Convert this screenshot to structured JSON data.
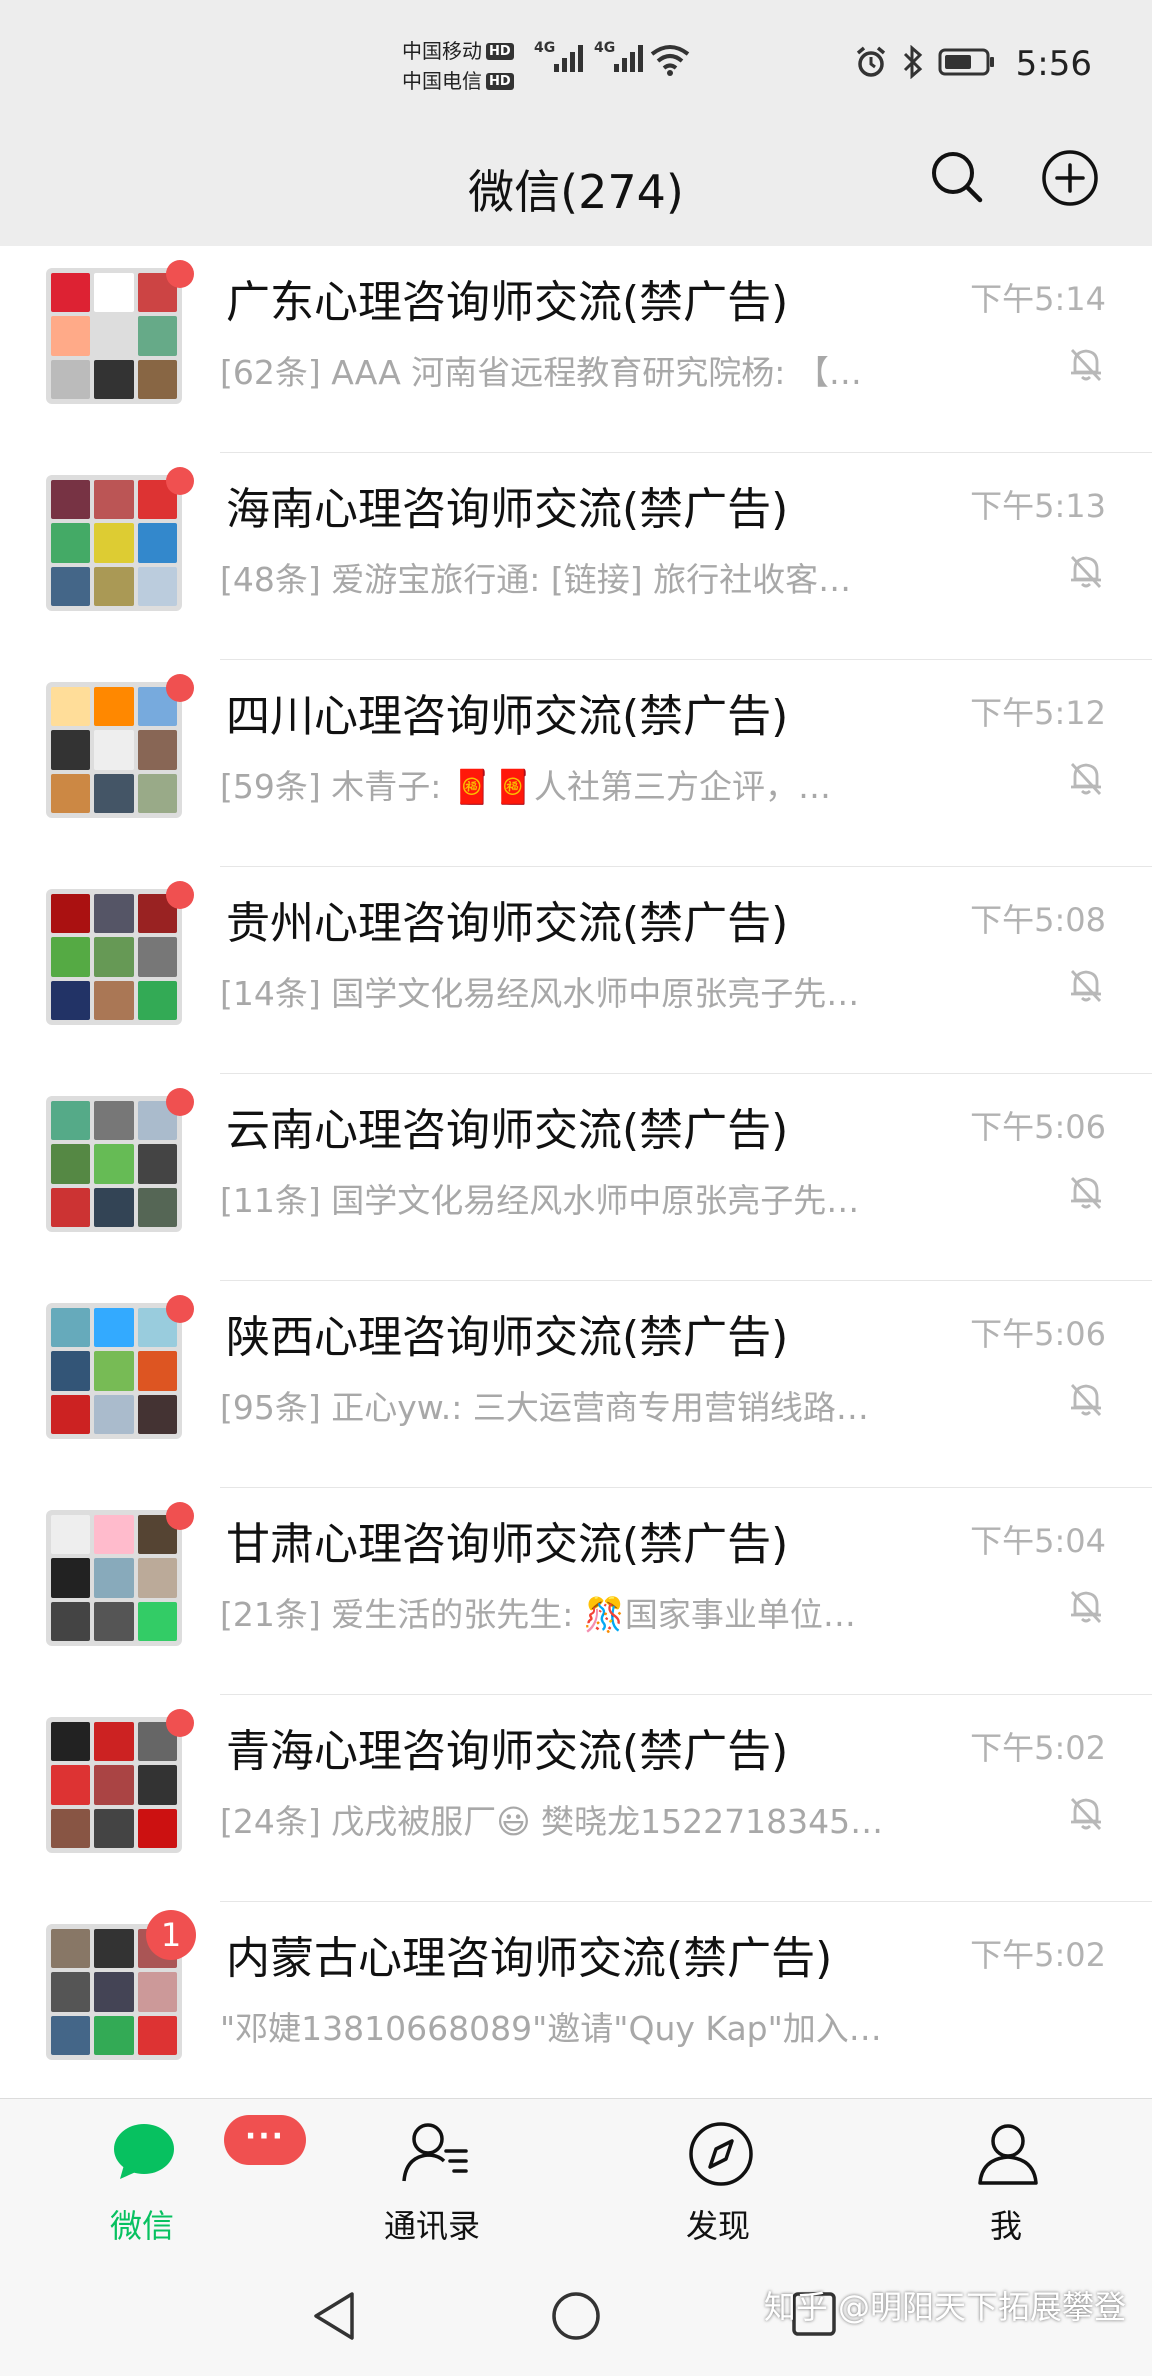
{
  "status_bar": {
    "carrier1": "中国移动",
    "carrier2": "中国电信",
    "hd": "HD",
    "network1": "4G",
    "network2": "4G",
    "time": "5:56"
  },
  "header": {
    "title": "微信(274)",
    "search_icon": "search-icon",
    "add_icon": "plus-circle-icon"
  },
  "chats": [
    {
      "name": "广东心理咨询师交流(禁广告)",
      "time": "下午5:14",
      "preview": "[62条] AAA  河南省远程教育研究院杨: 【…",
      "muted": true,
      "badge": "dot"
    },
    {
      "name": "海南心理咨询师交流(禁广告)",
      "time": "下午5:13",
      "preview": "[48条] 爱游宝旅行通: [链接] 旅行社收客…",
      "muted": true,
      "badge": "dot"
    },
    {
      "name": "四川心理咨询师交流(禁广告)",
      "time": "下午5:12",
      "preview": "[59条] 木青子: 🧧🧧人社第三方企评，…",
      "muted": true,
      "badge": "dot"
    },
    {
      "name": "贵州心理咨询师交流(禁广告)",
      "time": "下午5:08",
      "preview": "[14条] 国学文化易经风水师中原张亮子先…",
      "muted": true,
      "badge": "dot"
    },
    {
      "name": "云南心理咨询师交流(禁广告)",
      "time": "下午5:06",
      "preview": "[11条] 国学文化易经风水师中原张亮子先…",
      "muted": true,
      "badge": "dot"
    },
    {
      "name": "陕西心理咨询师交流(禁广告)",
      "time": "下午5:06",
      "preview": "[95条] 正心yw.: 三大运营商专用营销线路…",
      "muted": true,
      "badge": "dot"
    },
    {
      "name": "甘肃心理咨询师交流(禁广告)",
      "time": "下午5:04",
      "preview": "[21条] 爱生活的张先生: 🎊国家事业单位…",
      "muted": true,
      "badge": "dot"
    },
    {
      "name": "青海心理咨询师交流(禁广告)",
      "time": "下午5:02",
      "preview": "[24条] 戊戌被服厂😃 樊晓龙1522718345…",
      "muted": true,
      "badge": "dot"
    },
    {
      "name": "内蒙古心理咨询师交流(禁广告)",
      "time": "下午5:02",
      "preview": "\"邓婕13810668089\"邀请\"Quy  Kap\"加入…",
      "muted": false,
      "badge": "1"
    }
  ],
  "tabs": [
    {
      "label": "微信",
      "icon": "chat-bubble-icon",
      "active": true,
      "badge": "···"
    },
    {
      "label": "通讯录",
      "icon": "contacts-icon",
      "active": false
    },
    {
      "label": "发现",
      "icon": "compass-icon",
      "active": false
    },
    {
      "label": "我",
      "icon": "person-icon",
      "active": false
    }
  ],
  "nav": {
    "watermark": "知乎 @明阳天下拓展攀登"
  },
  "colors": {
    "accent": "#07c160",
    "badge": "#f05050",
    "background": "#ededed"
  }
}
